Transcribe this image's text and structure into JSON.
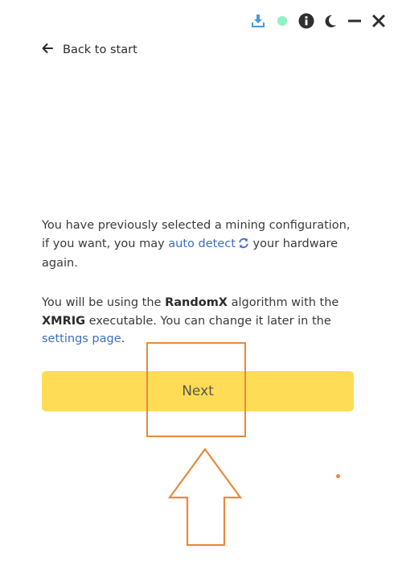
{
  "window_controls": {
    "icons": [
      "download-icon",
      "status-dot-icon",
      "info-icon",
      "moon-icon",
      "minimize-icon",
      "close-icon"
    ],
    "colors": {
      "download": "#4a9ad6",
      "status_dot": "#8ef0c3",
      "dark": "#2f2f2f"
    }
  },
  "back": {
    "label": "Back to start"
  },
  "intro": {
    "text_before": "You have previously selected a mining configuration, if you want, you may ",
    "auto_detect_link": "auto detect",
    "text_after": " your hardware again."
  },
  "algorithm": {
    "text_1": "You will be using the ",
    "algorithm_name": "RandomX",
    "text_2": " algorithm with the ",
    "executable_name": "XMRIG",
    "text_3": " executable. You can change it later in the ",
    "settings_link": "settings page",
    "text_4": "."
  },
  "next_button": {
    "label": "Next",
    "color": "#ffdc55"
  },
  "annotation": {
    "color": "#e88a3a"
  }
}
